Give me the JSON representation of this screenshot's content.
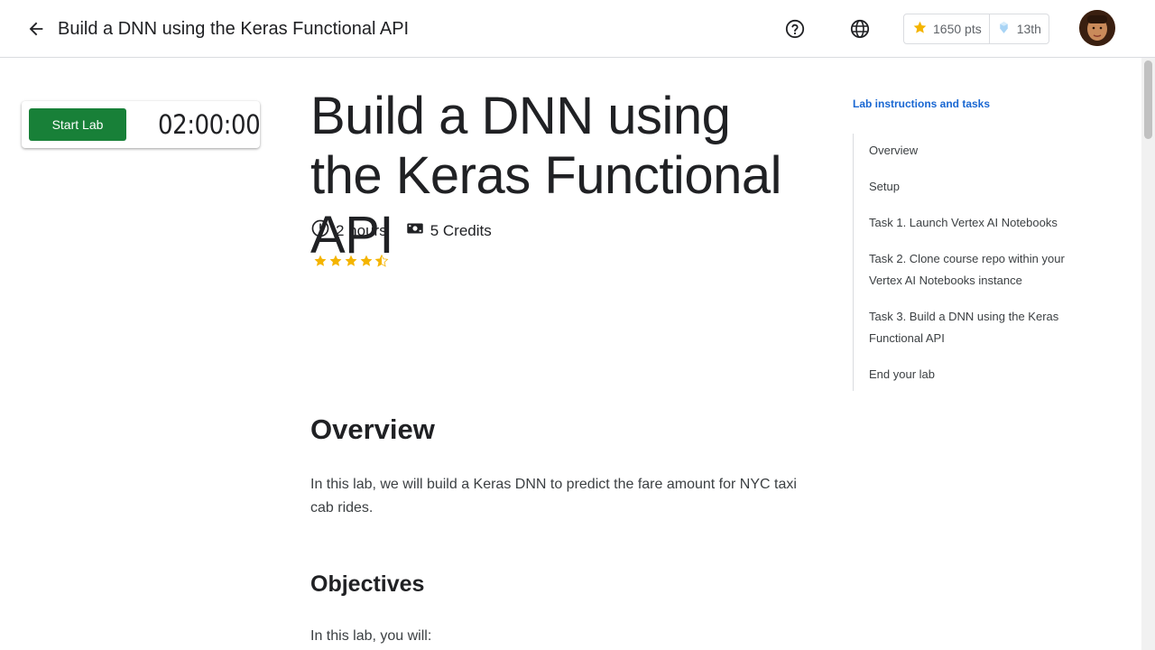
{
  "header": {
    "back_icon": "arrow-back-icon",
    "title": "Build a DNN using the Keras Functional API",
    "help_icon": "help-circle-icon",
    "language_icon": "globe-icon",
    "points": "1650 pts",
    "rank": "13th",
    "avatar_icon": "avatar-photo"
  },
  "lab_card": {
    "start_label": "Start Lab",
    "timer": "02:00:00",
    "start_color": "#188038"
  },
  "main": {
    "title": "Build a DNN using the Keras Functional API",
    "duration": "2 hours",
    "credits": "5 Credits",
    "rating": 4.5,
    "rating_max": 5,
    "overview_heading": "Overview",
    "overview_text": "In this lab, we will build a Keras DNN to predict the fare amount for NYC taxi cab rides.",
    "objectives_heading": "Objectives",
    "objectives_intro": "In this lab, you will:"
  },
  "toc": {
    "heading": "Lab instructions and tasks",
    "items": [
      "Overview",
      "Setup",
      "Task 1. Launch Vertex AI Notebooks",
      "Task 2. Clone course repo within your Vertex AI Notebooks instance",
      "Task 3. Build a DNN using the Keras Functional API",
      "End your lab"
    ]
  },
  "colors": {
    "accent": "#1967d2",
    "star": "#f4b400",
    "button": "#188038"
  }
}
